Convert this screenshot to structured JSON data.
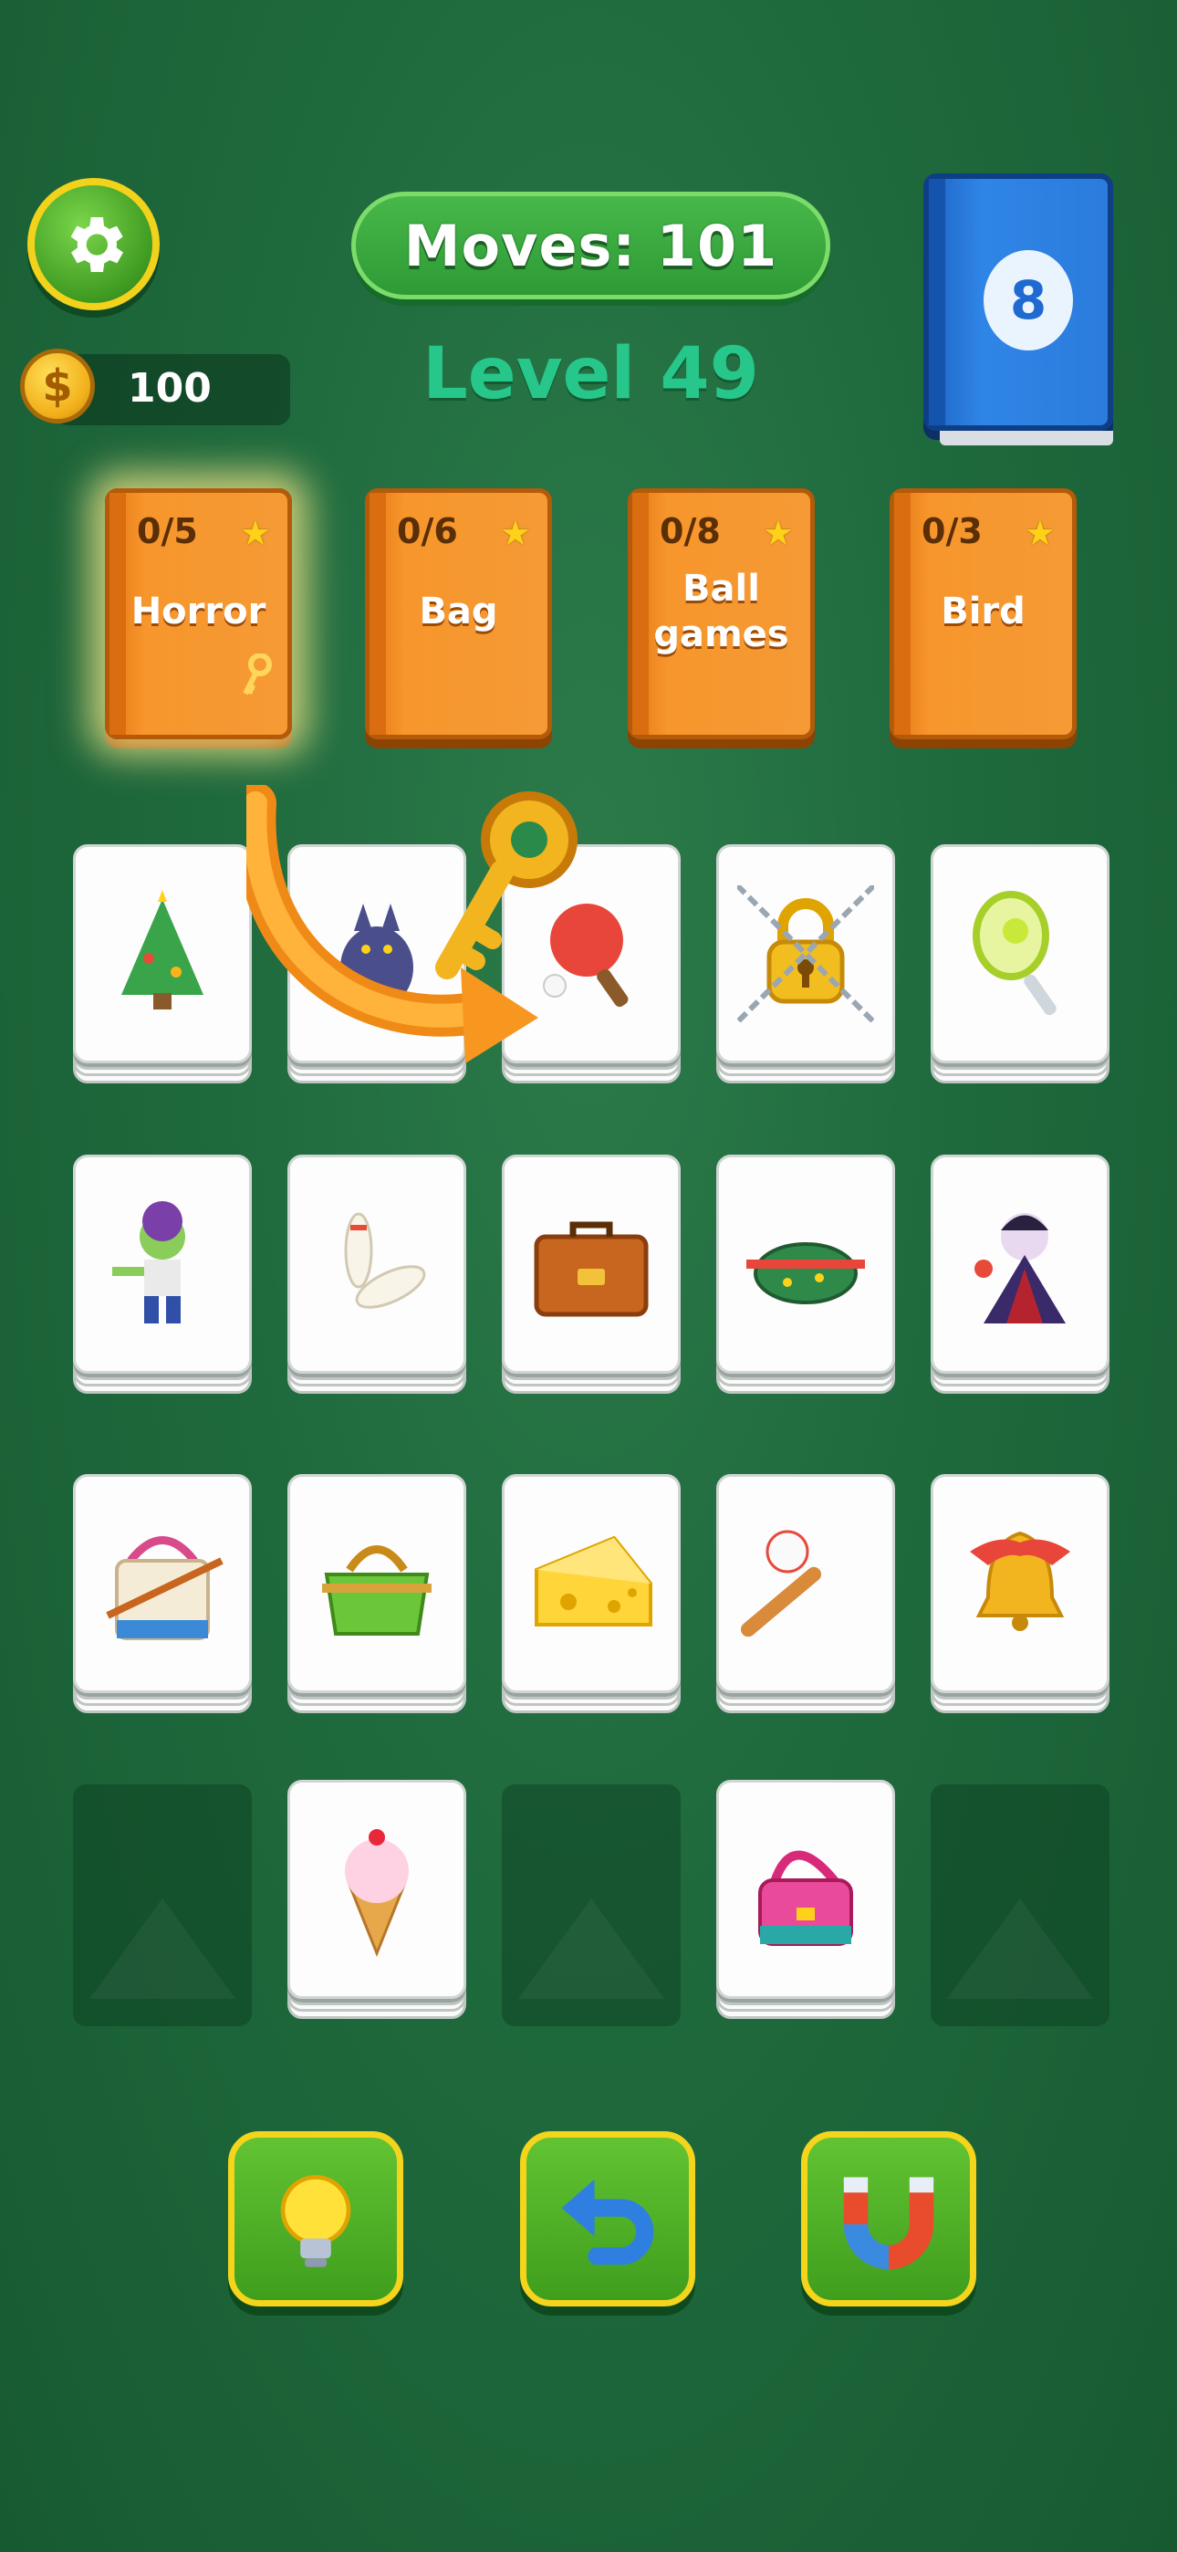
{
  "header": {
    "moves_label": "Moves: 101",
    "level_label": "Level 49",
    "coins": "100",
    "coin_symbol": "$",
    "deck_count": "8"
  },
  "categories": [
    {
      "count": "0/5",
      "name": "Horror",
      "has_key": true,
      "highlighted": true
    },
    {
      "count": "0/6",
      "name": "Bag"
    },
    {
      "count": "0/8",
      "name_line1": "Ball",
      "name_line2": "games"
    },
    {
      "count": "0/3",
      "name": "Bird"
    }
  ],
  "tiles": [
    {
      "icon": "christmas-tree-icon"
    },
    {
      "icon": "werewolf-icon"
    },
    {
      "icon": "ping-pong-icon"
    },
    {
      "icon": "locked-tile-padlock-icon",
      "locked": true
    },
    {
      "icon": "tennis-racket-icon"
    },
    {
      "icon": "zombie-icon"
    },
    {
      "icon": "bowling-pins-icon"
    },
    {
      "icon": "briefcase-icon"
    },
    {
      "icon": "fanny-pack-icon"
    },
    {
      "icon": "vampire-icon"
    },
    {
      "icon": "tote-bag-icon"
    },
    {
      "icon": "green-handbag-icon"
    },
    {
      "icon": "cheese-icon"
    },
    {
      "icon": "baseball-bat-icon"
    },
    {
      "icon": "christmas-bell-icon"
    },
    {
      "icon": "empty"
    },
    {
      "icon": "ice-cream-icon"
    },
    {
      "icon": "empty"
    },
    {
      "icon": "pink-shoulder-bag-icon"
    },
    {
      "icon": "empty"
    }
  ],
  "boosters": [
    {
      "icon": "lightbulb-icon"
    },
    {
      "icon": "undo-icon"
    },
    {
      "icon": "magnet-icon"
    }
  ],
  "colors": {
    "background": "#1f6a3d",
    "category_book": "#f59a35",
    "deck_book": "#2f85e6",
    "booster_border": "#f4d51c"
  }
}
